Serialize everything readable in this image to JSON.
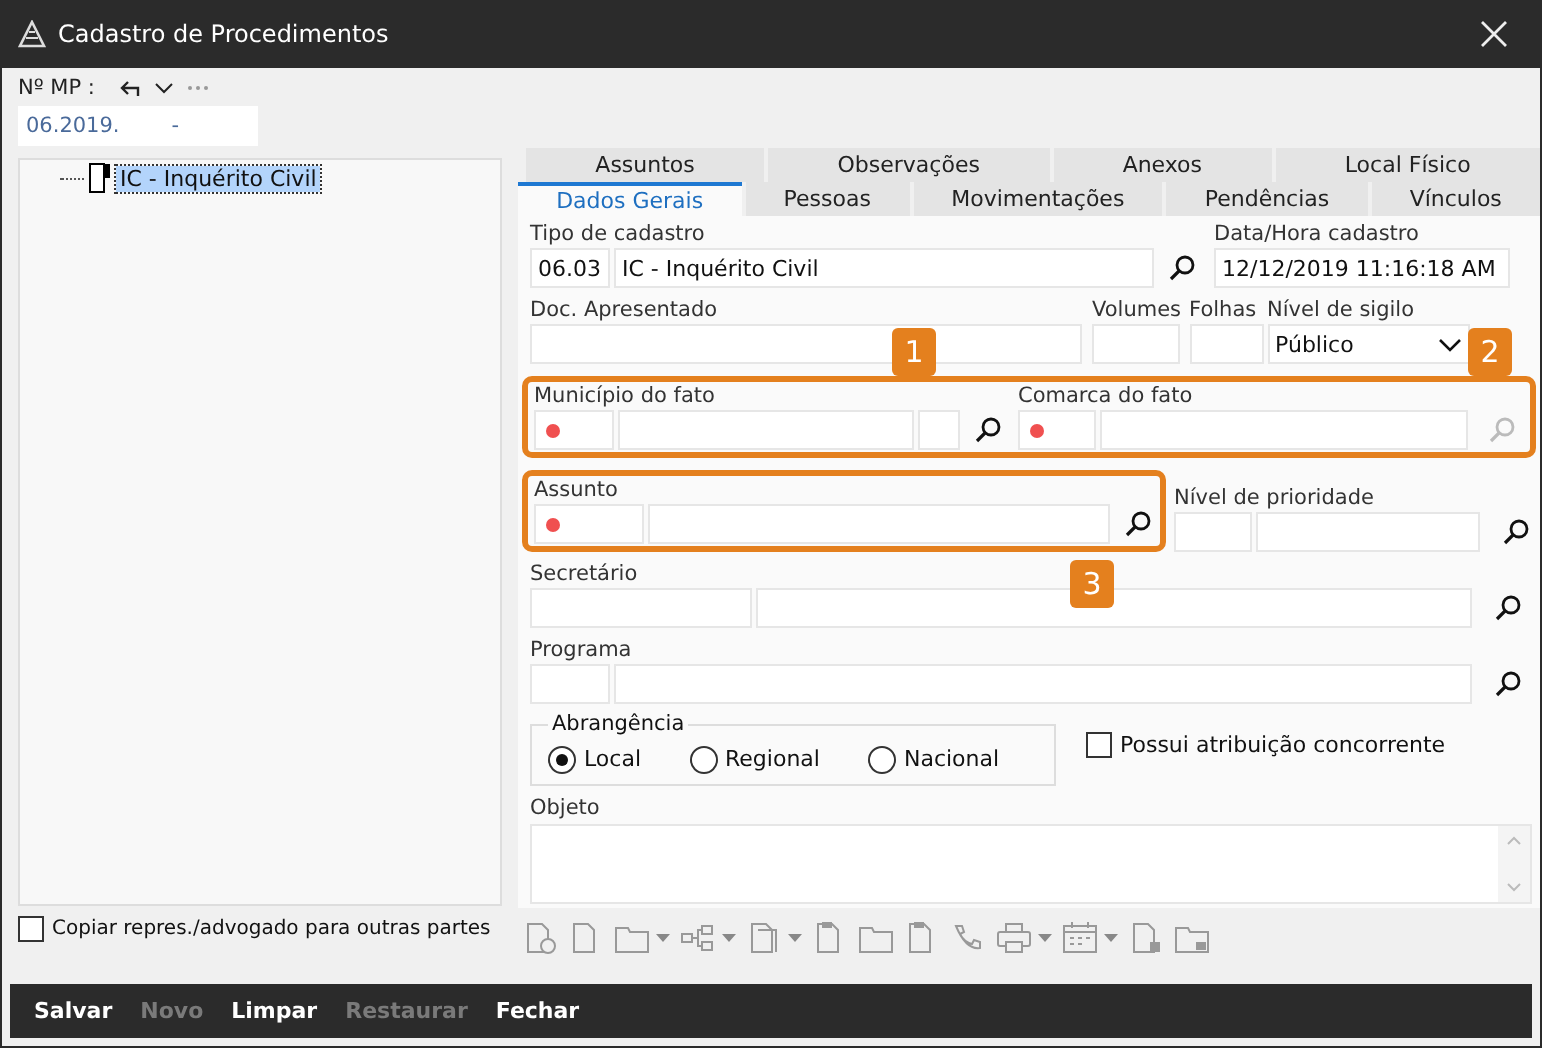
{
  "window": {
    "title": "Cadastro de Procedimentos"
  },
  "mp": {
    "label": "Nº MP :",
    "value": "06.2019.",
    "suffix": "-"
  },
  "tree": [
    {
      "label": "IC - Inquérito Civil",
      "selected": true
    }
  ],
  "copy_checkbox": {
    "label": "Copiar repres./advogado para outras partes",
    "checked": false
  },
  "tab_rows": [
    [
      {
        "label": "Assuntos",
        "selected": false
      },
      {
        "label": "Observações",
        "selected": false
      },
      {
        "label": "Anexos",
        "selected": false
      },
      {
        "label": "Local Físico",
        "selected": false
      }
    ],
    [
      {
        "label": "Dados Gerais",
        "selected": true
      },
      {
        "label": "Pessoas",
        "selected": false
      },
      {
        "label": "Movimentações",
        "selected": false
      },
      {
        "label": "Pendências",
        "selected": false
      },
      {
        "label": "Vínculos",
        "selected": false
      }
    ]
  ],
  "form": {
    "tipo": {
      "label": "Tipo de cadastro",
      "code": "06.03",
      "value": "IC - Inquérito Civil"
    },
    "data_hora": {
      "label": "Data/Hora cadastro",
      "value": "12/12/2019 11:16:18 AM"
    },
    "doc": {
      "label": "Doc. Apresentado"
    },
    "volumes": {
      "label": "Volumes"
    },
    "folhas": {
      "label": "Folhas"
    },
    "sigilo": {
      "label": "Nível de sigilo",
      "value": "Público"
    },
    "municipio": {
      "label": "Município do fato",
      "required": true,
      "disabled": false
    },
    "comarca": {
      "label": "Comarca do fato",
      "required": true,
      "disabled": true
    },
    "assunto": {
      "label": "Assunto",
      "required": true,
      "disabled": false
    },
    "prioridade": {
      "label": "Nível de prioridade",
      "disabled": false
    },
    "secretario": {
      "label": "Secretário"
    },
    "programa": {
      "label": "Programa"
    },
    "abrangencia": {
      "legend": "Abrangência",
      "options": [
        {
          "label": "Local",
          "selected": true
        },
        {
          "label": "Regional",
          "selected": false
        },
        {
          "label": "Nacional",
          "selected": false
        }
      ]
    },
    "concorrente": {
      "label": "Possui atribuição concorrente",
      "checked": false
    },
    "objeto": {
      "label": "Objeto"
    }
  },
  "callouts": [
    {
      "number": "1"
    },
    {
      "number": "2"
    },
    {
      "number": "3"
    }
  ],
  "buttons": [
    {
      "label": "Salvar",
      "disabled": false
    },
    {
      "label": "Novo",
      "disabled": true
    },
    {
      "label": "Limpar",
      "disabled": false
    },
    {
      "label": "Restaurar",
      "disabled": true
    },
    {
      "label": "Fechar",
      "disabled": false
    }
  ]
}
